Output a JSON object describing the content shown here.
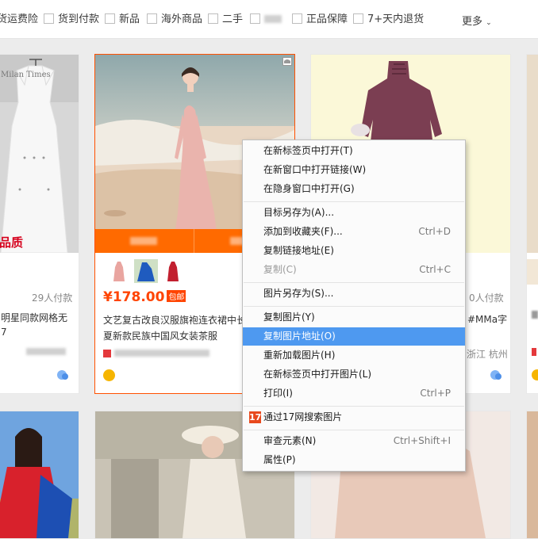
{
  "filters": {
    "items": [
      {
        "label": "货运费险",
        "checkbox": false
      },
      {
        "label": "货到付款",
        "checkbox": true
      },
      {
        "label": "新品",
        "checkbox": true
      },
      {
        "label": "海外商品",
        "checkbox": true
      },
      {
        "label": "二手",
        "checkbox": true
      },
      {
        "label": "",
        "checkbox": true,
        "blurred": true
      },
      {
        "label": "正品保障",
        "checkbox": true
      },
      {
        "label": "7+天内退货",
        "checkbox": true
      }
    ],
    "more_label": "更多"
  },
  "cards": {
    "left": {
      "corner_text": "Milan Times",
      "quality_text": "品质",
      "sales": "29人付款",
      "title_line1": "明星同款网格无",
      "title_line2": "7"
    },
    "center": {
      "price": "¥178.00",
      "baoyou": "包邮",
      "title": "文艺复古改良汉服旗袍连衣裙中长夏新款民族中国风女装茶服"
    },
    "right": {
      "sales": "0人付款",
      "title": "#MMa字",
      "location": "浙江 杭州"
    }
  },
  "context_menu": {
    "items": [
      {
        "label": "在新标签页中打开(T)",
        "shortcut": ""
      },
      {
        "label": "在新窗口中打开链接(W)",
        "shortcut": ""
      },
      {
        "label": "在隐身窗口中打开(G)",
        "shortcut": ""
      },
      {
        "label": "目标另存为(A)...",
        "shortcut": ""
      },
      {
        "label": "添加到收藏夹(F)...",
        "shortcut": "Ctrl+D"
      },
      {
        "label": "复制链接地址(E)",
        "shortcut": ""
      },
      {
        "label": "复制(C)",
        "shortcut": "Ctrl+C",
        "disabled": true
      },
      {
        "label": "图片另存为(S)...",
        "shortcut": ""
      },
      {
        "label": "复制图片(Y)",
        "shortcut": ""
      },
      {
        "label": "复制图片地址(O)",
        "shortcut": "",
        "active": true
      },
      {
        "label": "重新加载图片(H)",
        "shortcut": ""
      },
      {
        "label": "在新标签页中打开图片(L)",
        "shortcut": ""
      },
      {
        "label": "打印(I)",
        "shortcut": "Ctrl+P"
      },
      {
        "label": "通过17网搜索图片",
        "shortcut": "",
        "logo": "17"
      },
      {
        "label": "审查元素(N)",
        "shortcut": "Ctrl+Shift+I"
      },
      {
        "label": "属性(P)",
        "shortcut": ""
      }
    ]
  },
  "colors": {
    "accent": "#ff4400",
    "badge_bar": "#ff6a00",
    "menu_highlight": "#4e99f0"
  }
}
